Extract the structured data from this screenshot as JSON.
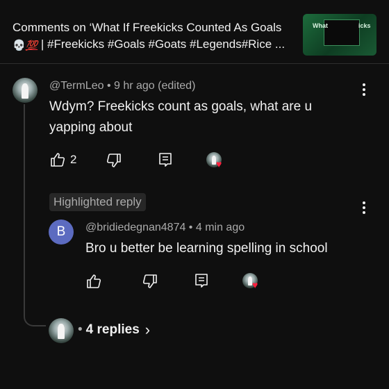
{
  "header": {
    "title_line1": "Comments on ‘What If Freekicks Counted As Goals",
    "title_line2_emoji1": "💀",
    "title_line2_emoji2": "💯",
    "title_line2": " | #Freekicks #Goals #Goats #Legends#Rice ...",
    "thumbnail_text_left": "What",
    "thumbnail_text_right": "icks"
  },
  "comment": {
    "username": "@TermLeo",
    "meta": " • 9 hr ago (edited)",
    "text": "Wdym? Freekicks count as goals, what are u yapping about",
    "like_count": "2",
    "icons": [
      "like-icon",
      "dislike-icon",
      "reply-icon",
      "creator-heart-icon",
      "more-vert-icon"
    ]
  },
  "highlighted_badge": "Highlighted reply",
  "reply": {
    "avatar_letter": "B",
    "avatar_color": "#5c6bc0",
    "username": "@bridiedegnan4874",
    "meta": " • 4 min ago",
    "text": "Bro u better be learning spelling in school"
  },
  "replies_link": {
    "dot": "•",
    "label": "4 replies",
    "chevron": "›"
  },
  "colors": {
    "background": "#0f0f0f",
    "heart": "#ff1f3d",
    "muted": "#aaaaaa"
  }
}
